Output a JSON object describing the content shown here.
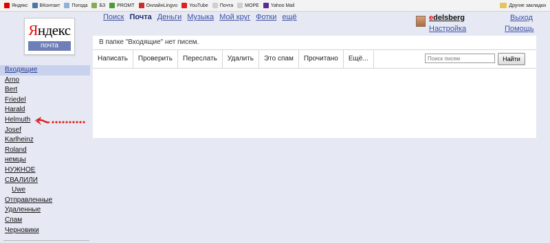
{
  "bookmarks": [
    {
      "label": "Яндекс",
      "icon": "yandex-icon",
      "color": "#e00000"
    },
    {
      "label": "ВКонтакт",
      "icon": "vk-icon",
      "color": "#4a76a8"
    },
    {
      "label": "Погода",
      "icon": "weather-icon",
      "color": "#8fb1d9"
    },
    {
      "label": "БЗ",
      "icon": "book-icon",
      "color": "#88aa55"
    },
    {
      "label": "PROMT",
      "icon": "promt-icon",
      "color": "#4b9a3c"
    },
    {
      "label": "ОнлайнLingvo",
      "icon": "lingvo-icon",
      "color": "#d02a2a"
    },
    {
      "label": "YouTube",
      "icon": "youtube-icon",
      "color": "#e02020"
    },
    {
      "label": "Почта",
      "icon": "page-icon",
      "color": "#cfcfcf"
    },
    {
      "label": "МОРЕ",
      "icon": "page-icon",
      "color": "#cfcfcf"
    },
    {
      "label": "Yahoo Mail",
      "icon": "yahoo-icon",
      "color": "#5c2d91"
    }
  ],
  "other_bookmarks": "Другие закладки",
  "logo": {
    "main_first": "Я",
    "main_rest": "ндекс",
    "sub": "почта"
  },
  "topnav": [
    "Поиск",
    "Почта",
    "Деньги",
    "Музыка",
    "Мой круг",
    "Фотки",
    "ещё"
  ],
  "topnav_active": "Почта",
  "user": {
    "name_first": "e",
    "name_rest": "delsberg",
    "settings": "Настройка",
    "logout": "Выход",
    "help": "Помощь"
  },
  "notice": "В папке \"Входящие\" нет писем.",
  "toolbar": [
    "Написать",
    "Проверить",
    "Переслать",
    "Удалить",
    "Это спам",
    "Прочитано",
    "Ещё..."
  ],
  "search": {
    "placeholder": "Поиск писем",
    "button": "Найти"
  },
  "folders": [
    {
      "label": "Входящие",
      "active": true
    },
    {
      "label": "Arno"
    },
    {
      "label": "Bert"
    },
    {
      "label": "Friedel"
    },
    {
      "label": "Harald"
    },
    {
      "label": "Helmuth"
    },
    {
      "label": "Josef"
    },
    {
      "label": "Karlheinz"
    },
    {
      "label": "Roland"
    },
    {
      "label": "немцы"
    },
    {
      "label": "НУЖНОЕ"
    },
    {
      "label": "СВАЛИЛИ"
    },
    {
      "label": "Uwe",
      "sub": true
    },
    {
      "label": "Отправленные"
    },
    {
      "label": "Удаленные"
    },
    {
      "label": "Спам"
    },
    {
      "label": "Черновики"
    }
  ],
  "colors": {
    "accent": "#3b4fa6",
    "active_folder_bg": "#c8d2ef",
    "annotation": "#e02020",
    "page_bg": "#e6e9f3"
  }
}
